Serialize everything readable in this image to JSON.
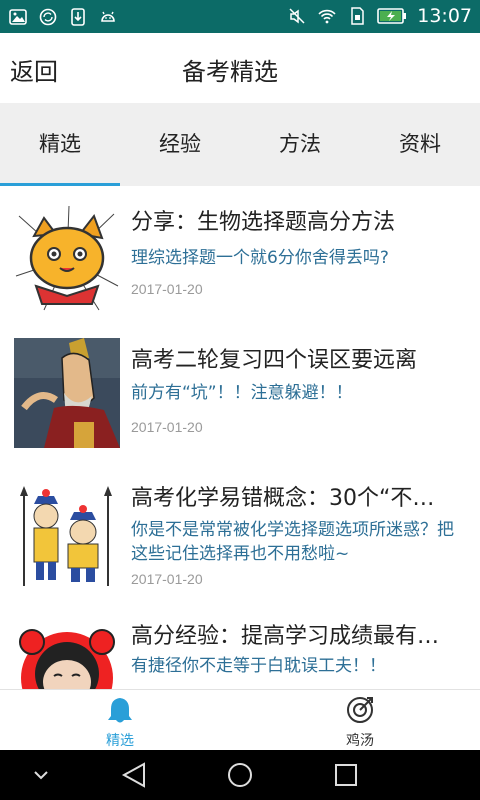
{
  "status_bar": {
    "time": "13:07",
    "left_icons": [
      "image-icon",
      "sync-icon",
      "download-icon",
      "android-icon"
    ],
    "right_icons": [
      "vibrate-off-icon",
      "wifi-icon",
      "sim-icon",
      "battery-charging-icon"
    ]
  },
  "header": {
    "back_label": "返回",
    "title": "备考精选"
  },
  "tabs": [
    {
      "label": "精选",
      "active": true
    },
    {
      "label": "经验",
      "active": false
    },
    {
      "label": "方法",
      "active": false
    },
    {
      "label": "资料",
      "active": false
    }
  ],
  "articles": [
    {
      "title": "分享：生物选择题高分方法",
      "summary": "理综选择题一个就6分你舍得丢吗?",
      "date": "2017-01-20",
      "thumb": "cartoon-cat-icon"
    },
    {
      "title": "高考二轮复习四个误区要远离",
      "summary": "前方有“坑”！！注意躲避！！",
      "date": "2017-01-20",
      "thumb": "cartoon-man-icon"
    },
    {
      "title": "高考化学易错概念：30个“不…",
      "summary": "你是不是常常被化学选择题选项所迷惑？把这些记住选择再也不用愁啦~",
      "date": "2017-01-20",
      "thumb": "cartoon-guards-icon"
    },
    {
      "title": "高分经验：提高学习成绩最有…",
      "summary": "有捷径你不走等于白耽误工夫！！",
      "date": "",
      "thumb": "cartoon-face-icon"
    }
  ],
  "bottom_nav": [
    {
      "label": "精选",
      "icon": "bell-icon",
      "active": true
    },
    {
      "label": "鸡汤",
      "icon": "target-icon",
      "active": false
    }
  ],
  "colors": {
    "status_bar": "#0c6b67",
    "accent": "#2a9fd8",
    "summary_text": "#2d6f96",
    "tab_bar_bg": "#efefef"
  }
}
